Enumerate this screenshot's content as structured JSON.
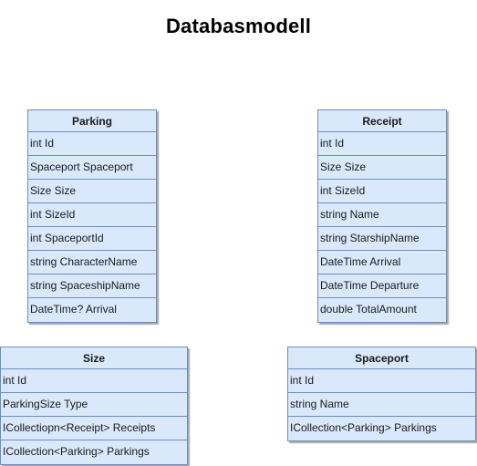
{
  "title": "Databasmodell",
  "entities": {
    "parking": {
      "name": "Parking",
      "fields": [
        "int Id",
        "Spaceport Spaceport",
        "Size Size",
        "int SizeId",
        "int SpaceportId",
        "string CharacterName",
        "string SpaceshipName",
        "DateTime? Arrival"
      ]
    },
    "receipt": {
      "name": "Receipt",
      "fields": [
        "int Id",
        "Size Size",
        "int SizeId",
        "string Name",
        "string StarshipName",
        "DateTime Arrival",
        "DateTime Departure",
        "double TotalAmount"
      ]
    },
    "size": {
      "name": "Size",
      "fields": [
        "int Id",
        "ParkingSize Type",
        "ICollectiopn<Receipt> Receipts",
        "ICollection<Parking> Parkings"
      ]
    },
    "spaceport": {
      "name": "Spaceport",
      "fields": [
        "int Id",
        "string Name",
        "ICollection<Parking> Parkings"
      ]
    }
  },
  "colors": {
    "entity_fill": "#dae8fc",
    "entity_border": "#6c8ebf"
  }
}
